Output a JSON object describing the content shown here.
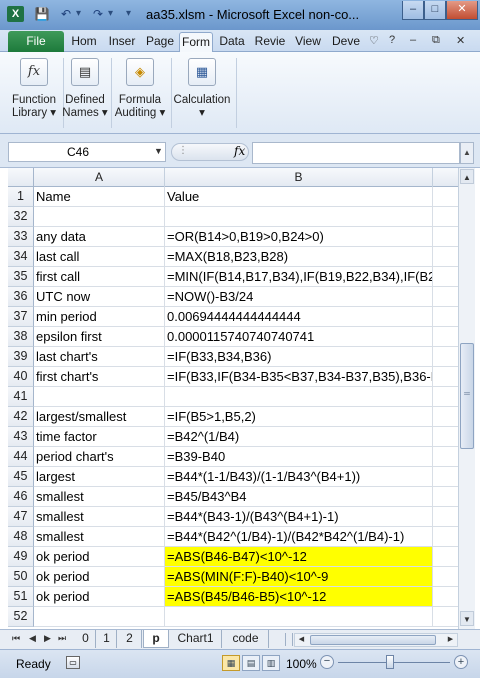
{
  "window": {
    "title": "aa35.xlsm - Microsoft Excel non-co...",
    "minimize": "–",
    "maximize": "□",
    "close": "✕"
  },
  "quick_access": {
    "app_icon": "X",
    "save": "💾",
    "undo": "↶",
    "redo": "↷"
  },
  "ribbon_tabs": {
    "file": "File",
    "items": [
      "Hom",
      "Inser",
      "Page",
      "Form",
      "Data",
      "Revie",
      "View",
      "Deve"
    ],
    "active": "Form",
    "controls": [
      "♡",
      "?",
      "–",
      "⧉",
      "✕"
    ]
  },
  "ribbon_groups": [
    {
      "icon": "fx",
      "line1": "Function",
      "line2": "Library ▾"
    },
    {
      "icon": "▤",
      "line1": "Defined",
      "line2": "Names ▾"
    },
    {
      "icon": "◈",
      "line1": "Formula",
      "line2": "Auditing ▾"
    },
    {
      "icon": "▦",
      "line1": "Calculation",
      "line2": "▾"
    }
  ],
  "formula_bar": {
    "name_box": "C46",
    "fx": "fx",
    "value": ""
  },
  "columns": [
    "A",
    "B"
  ],
  "rows": [
    {
      "num": "1",
      "a": "Name",
      "b": "Value",
      "hl": false
    },
    {
      "num": "32",
      "a": "",
      "b": "",
      "hl": false
    },
    {
      "num": "33",
      "a": "any data",
      "b": "=OR(B14>0,B19>0,B24>0)",
      "hl": false
    },
    {
      "num": "34",
      "a": "last call",
      "b": "=MAX(B18,B23,B28)",
      "hl": false
    },
    {
      "num": "35",
      "a": "first call",
      "b": "=MIN(IF(B14,B17,B34),IF(B19,B22,B34),IF(B2",
      "hl": false
    },
    {
      "num": "36",
      "a": "UTC now",
      "b": "=NOW()-B3/24",
      "hl": false
    },
    {
      "num": "37",
      "a": "min period",
      "b": "0.00694444444444444",
      "hl": false
    },
    {
      "num": "38",
      "a": "epsilon first",
      "b": "0.0000115740740740741",
      "hl": false
    },
    {
      "num": "39",
      "a": "last chart's",
      "b": "=IF(B33,B34,B36)",
      "hl": false
    },
    {
      "num": "40",
      "a": "first chart's",
      "b": "=IF(B33,IF(B34-B35<B37,B34-B37,B35),B36-B",
      "hl": false
    },
    {
      "num": "41",
      "a": "",
      "b": "",
      "hl": false
    },
    {
      "num": "42",
      "a": "largest/smallest",
      "b": "=IF(B5>1,B5,2)",
      "hl": false
    },
    {
      "num": "43",
      "a": "time factor",
      "b": "=B42^(1/B4)",
      "hl": false
    },
    {
      "num": "44",
      "a": "period chart's",
      "b": "=B39-B40",
      "hl": false
    },
    {
      "num": "45",
      "a": "largest",
      "b": "=B44*(1-1/B43)/(1-1/B43^(B4+1))",
      "hl": false
    },
    {
      "num": "46",
      "a": "smallest",
      "b": "=B45/B43^B4",
      "hl": false
    },
    {
      "num": "47",
      "a": "smallest",
      "b": "=B44*(B43-1)/(B43^(B4+1)-1)",
      "hl": false
    },
    {
      "num": "48",
      "a": "smallest",
      "b": "=B44*(B42^(1/B4)-1)/(B42*B42^(1/B4)-1)",
      "hl": false
    },
    {
      "num": "49",
      "a": "ok period",
      "b": "=ABS(B46-B47)<10^-12",
      "hl": true
    },
    {
      "num": "50",
      "a": "ok period",
      "b": "=ABS(MIN(F:F)-B40)<10^-9",
      "hl": true
    },
    {
      "num": "51",
      "a": "ok period",
      "b": "=ABS(B45/B46-B5)<10^-12",
      "hl": true
    },
    {
      "num": "52",
      "a": "",
      "b": "",
      "hl": false
    }
  ],
  "sheet_tabs": {
    "nav": [
      "⏮",
      "◀",
      "▶",
      "⏭"
    ],
    "tabs": [
      "0",
      "1",
      "2",
      "p",
      "Chart1",
      "code"
    ],
    "active": "p"
  },
  "status": {
    "ready": "Ready",
    "zoom": "100%",
    "zoom_level_percent": 100,
    "minus": "−",
    "plus": "+"
  },
  "colors": {
    "highlight": "#ffff00",
    "file_tab": "#1d7a3b"
  }
}
